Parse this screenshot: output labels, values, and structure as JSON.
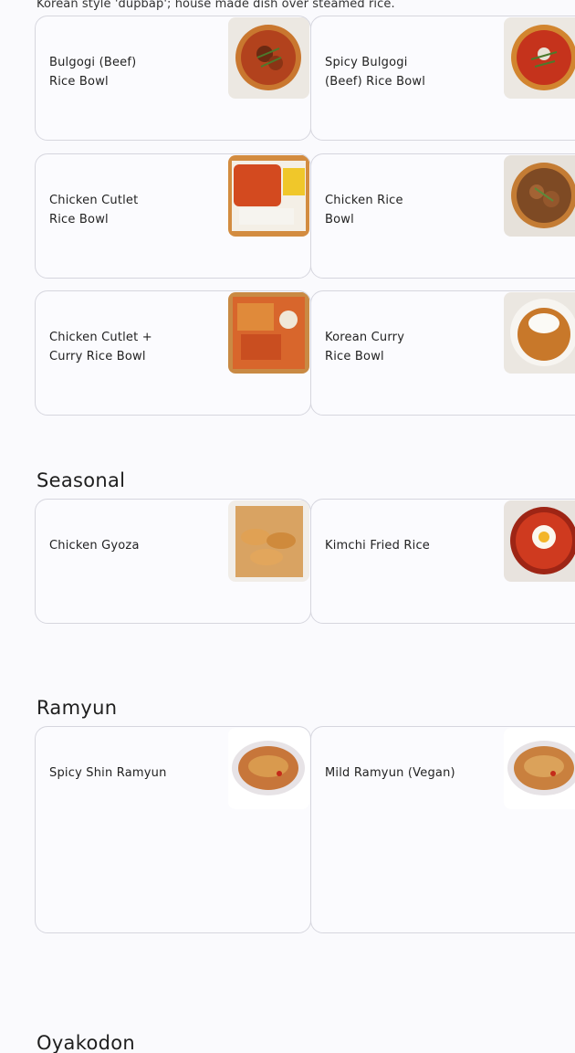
{
  "intro_text": "Korean style 'dupbap'; house made dish over steamed rice.",
  "sections": {
    "rice": {
      "items": [
        {
          "name": "Bulgogi (Beef)\nRice Bowl",
          "image": "bulgogi-bowl-image"
        },
        {
          "name": "Spicy Bulgogi\n(Beef) Rice Bowl",
          "image": "spicy-bulgogi-bowl-image"
        },
        {
          "name": "Chicken Cutlet\nRice Bowl",
          "image": "chicken-cutlet-bowl-image"
        },
        {
          "name": "Chicken Rice\nBowl",
          "image": "chicken-rice-bowl-image"
        },
        {
          "name": "Chicken Cutlet +\nCurry Rice Bowl",
          "image": "cutlet-curry-bowl-image"
        },
        {
          "name": "Korean Curry\nRice Bowl",
          "image": "korean-curry-bowl-image"
        }
      ]
    },
    "seasonal": {
      "title": "Seasonal",
      "items": [
        {
          "name": "Chicken Gyoza",
          "image": "gyoza-image"
        },
        {
          "name": "Kimchi Fried Rice",
          "image": "kimchi-fried-rice-image"
        }
      ]
    },
    "ramyun": {
      "title": "Ramyun",
      "items": [
        {
          "name": "Spicy Shin Ramyun",
          "image": "shin-ramyun-image"
        },
        {
          "name": "Mild Ramyun (Vegan)",
          "image": "mild-ramyun-image"
        }
      ]
    },
    "oyakodon": {
      "title": "Oyakodon"
    }
  },
  "colors": {
    "page_background": "#fafafd",
    "card_border": "#d6d6de",
    "card_background": "#fbfbfe"
  }
}
